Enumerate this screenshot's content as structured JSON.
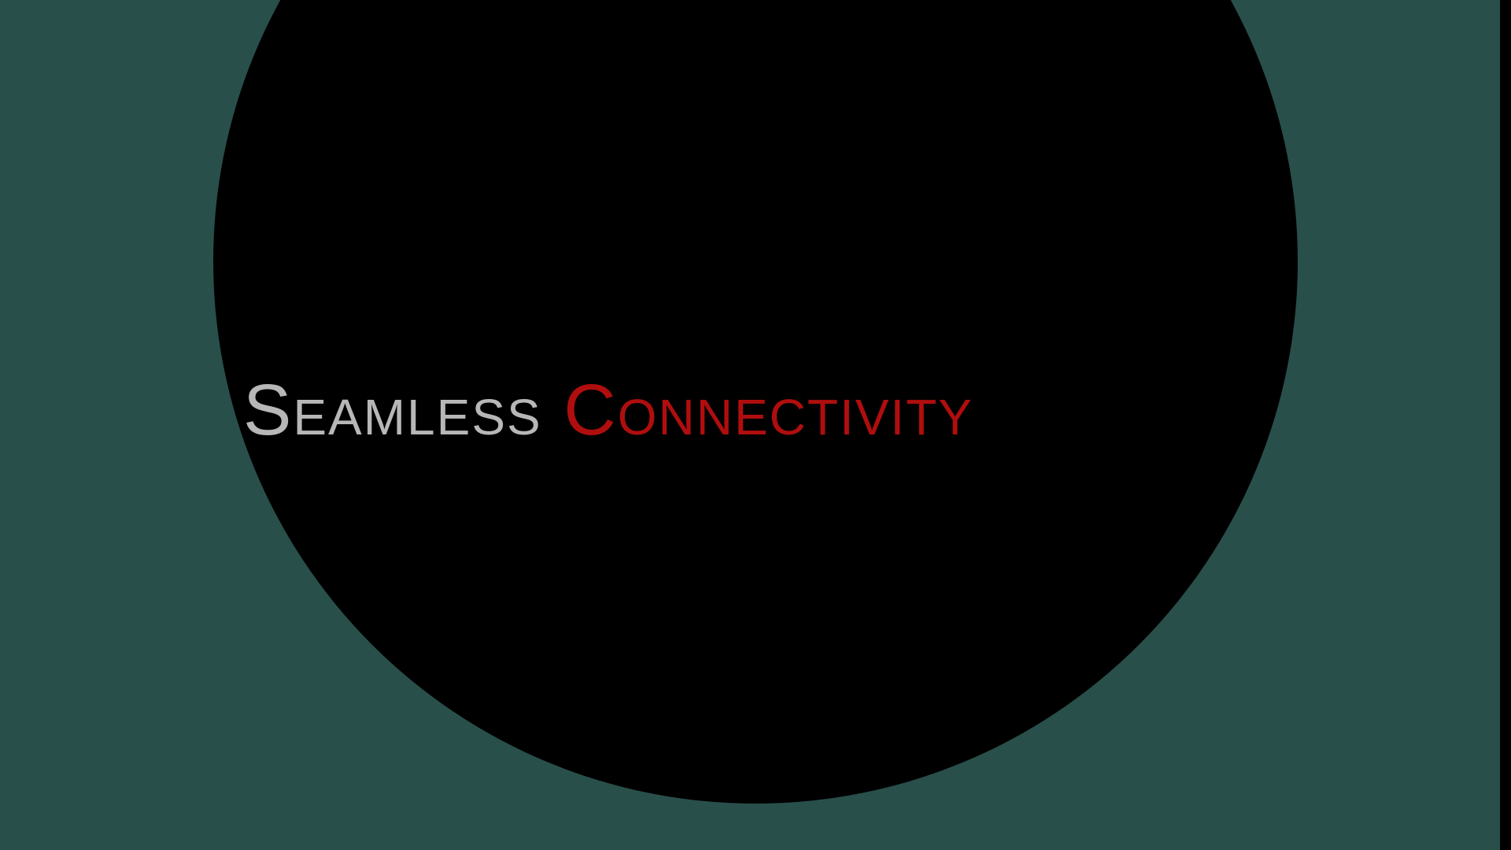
{
  "slide": {
    "title_part_1": "Seamless",
    "title_part_2": "Connectivity"
  },
  "colors": {
    "background": "#294f4b",
    "circle": "#000000",
    "title_part_1": "#b7b7b7",
    "title_part_2": "#b00e0e"
  }
}
